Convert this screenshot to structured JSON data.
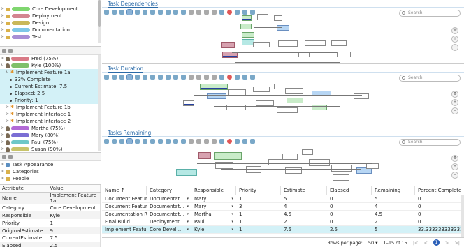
{
  "categories": [
    {
      "label": "Core Development",
      "color": "#7fd66f"
    },
    {
      "label": "Deployment",
      "color": "#d38590"
    },
    {
      "label": "Design",
      "color": "#c9b85a"
    },
    {
      "label": "Documentation",
      "color": "#7ec7e8"
    },
    {
      "label": "Test",
      "color": "#a88fd6"
    }
  ],
  "resources": {
    "fred": {
      "label": "Fred (75%)",
      "color": "#d97a86"
    },
    "kyle": {
      "label": "Kyle (100%)",
      "color": "#7ec06a"
    },
    "task": {
      "label": "Implement Feature 1a"
    },
    "details": [
      "33% Complete",
      "Current Estimate: 7.5",
      "Elapsed: 2.5",
      "Priority: 1"
    ],
    "tasks2": [
      "Implement Feature 1b",
      "Implement Interface 1",
      "Implement Interface 2"
    ],
    "others": [
      {
        "label": "Martha (75%)",
        "color": "#b36ad6"
      },
      {
        "label": "Mary (80%)",
        "color": "#7b6ed4"
      },
      {
        "label": "Paul (75%)",
        "color": "#6ec8c8"
      },
      {
        "label": "Susan (90%)",
        "color": "#c8c46a"
      }
    ]
  },
  "settings": [
    "Task Appearance",
    "Categories",
    "People"
  ],
  "properties": {
    "headers": [
      "Attribute",
      "Value"
    ],
    "rows": [
      [
        "Name",
        "Implement Feature 1a"
      ],
      [
        "Category",
        "Core Development"
      ],
      [
        "Responsible",
        "Kyle"
      ],
      [
        "Priority",
        "1"
      ],
      [
        "OriginalEstimate",
        "9"
      ],
      [
        "CurrentEstimate",
        "7.5"
      ],
      [
        "Elapsed",
        "2.5"
      ]
    ]
  },
  "panels": [
    "Task Dependencies",
    "Task Duration",
    "Tasks Remaining"
  ],
  "search_placeholder": "Search",
  "grid": {
    "headers": [
      "Name ↑",
      "Category",
      "Responsible",
      "Priority",
      "Estimate",
      "Elapsed",
      "Remaining",
      "Percent Complete"
    ],
    "rows": [
      [
        "Document Feature 1",
        "Documentat...",
        "Mary",
        "1",
        "5",
        "0",
        "5",
        "0"
      ],
      [
        "Document Feature 2",
        "Documentat...",
        "Mary",
        "3",
        "4",
        "0",
        "4",
        "0"
      ],
      [
        "Documentation Revi...",
        "Documentat...",
        "Martha",
        "1",
        "4.5",
        "0",
        "4.5",
        "0"
      ],
      [
        "Final Build",
        "Deployment",
        "Paul",
        "1",
        "2",
        "0",
        "2",
        "0"
      ],
      [
        "Implement Feature",
        "Core Devel...",
        "Kyle",
        "1",
        "7.5",
        "2.5",
        "5",
        "33.3333333333334"
      ]
    ],
    "rows_per_page_label": "Rows per page:",
    "rows_per_page": "50",
    "range": "1–15 of 15",
    "page": "1"
  },
  "colors": {
    "accent": "#2a6aa8",
    "selection": "#d3f1f7"
  }
}
